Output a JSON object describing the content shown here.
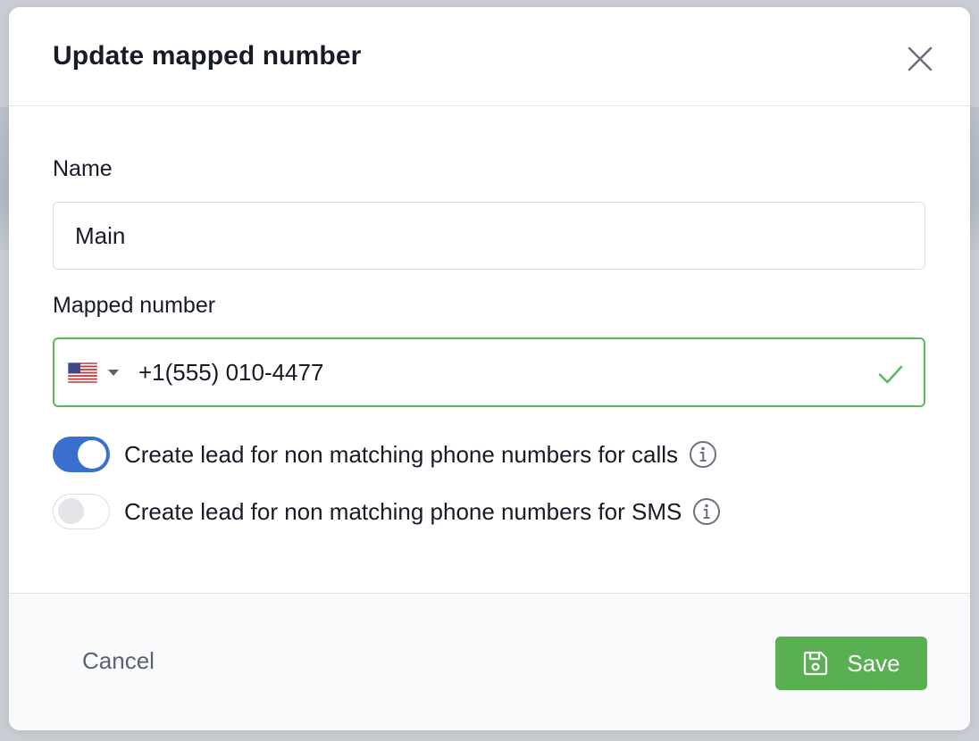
{
  "dialog": {
    "title": "Update mapped number"
  },
  "form": {
    "name_label": "Name",
    "name_value": "Main",
    "number_label": "Mapped number",
    "number_value": "+1(555) 010-4477",
    "country": "US"
  },
  "toggles": [
    {
      "label": "Create lead for non matching phone numbers for calls",
      "on": true
    },
    {
      "label": "Create lead for non matching phone numbers for SMS",
      "on": false
    }
  ],
  "footer": {
    "cancel_label": "Cancel",
    "save_label": "Save"
  },
  "icons": {
    "close": "close-icon",
    "valid": "check-icon",
    "info": "info-icon",
    "save": "floppy-disk-icon",
    "flag": "us-flag-icon"
  },
  "colors": {
    "accent": "#3a6fce",
    "success": "#5aaf53",
    "valid_border": "#5cb85c"
  }
}
